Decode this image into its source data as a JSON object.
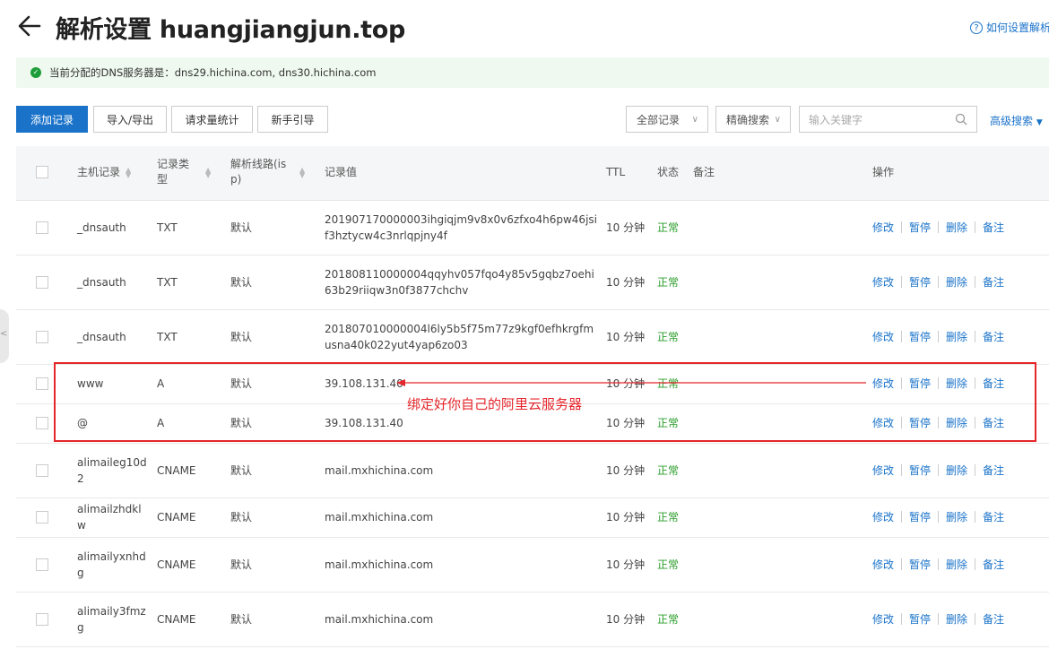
{
  "header": {
    "title": "解析设置 huangjiangjun.top",
    "help_label": "如何设置解析"
  },
  "notice": {
    "text": "当前分配的DNS服务器是：dns29.hichina.com, dns30.hichina.com"
  },
  "toolbar": {
    "add_label": "添加记录",
    "import_label": "导入/导出",
    "stats_label": "请求量统计",
    "guide_label": "新手引导",
    "filter_all": "全部记录",
    "search_mode": "精确搜索",
    "search_placeholder": "输入关键字",
    "advanced_label": "高级搜索"
  },
  "table": {
    "headers": {
      "host": "主机记录",
      "type": "记录类型",
      "line": "解析线路(isp)",
      "value": "记录值",
      "ttl": "TTL",
      "status": "状态",
      "remark": "备注",
      "ops": "操作"
    },
    "op_labels": [
      "修改",
      "暂停",
      "删除",
      "备注"
    ],
    "rows": [
      {
        "host": "_dnsauth",
        "type": "TXT",
        "line": "默认",
        "value": "201907170000003ihgiqjm9v8x0v6zfxo4h6pw46jsif3hztycw4c3nrlqpjny4f",
        "ttl": "10 分钟",
        "status": "正常"
      },
      {
        "host": "_dnsauth",
        "type": "TXT",
        "line": "默认",
        "value": "201808110000004qqyhv057fqo4y85v5gqbz7oehi63b29riiqw3n0f3877chchv",
        "ttl": "10 分钟",
        "status": "正常"
      },
      {
        "host": "_dnsauth",
        "type": "TXT",
        "line": "默认",
        "value": "201807010000004l6ly5b5f75m77z9kgf0efhkrgfmusna40k022yut4yap6zo03",
        "ttl": "10 分钟",
        "status": "正常"
      },
      {
        "host": "www",
        "type": "A",
        "line": "默认",
        "value": "39.108.131.40",
        "ttl": "10 分钟",
        "status": "正常"
      },
      {
        "host": "@",
        "type": "A",
        "line": "默认",
        "value": "39.108.131.40",
        "ttl": "10 分钟",
        "status": "正常"
      },
      {
        "host": "alimaileg10d2",
        "type": "CNAME",
        "line": "默认",
        "value": "mail.mxhichina.com",
        "ttl": "10 分钟",
        "status": "正常"
      },
      {
        "host": "alimailzhdklw",
        "type": "CNAME",
        "line": "默认",
        "value": "mail.mxhichina.com",
        "ttl": "10 分钟",
        "status": "正常"
      },
      {
        "host": "alimailyxnhdg",
        "type": "CNAME",
        "line": "默认",
        "value": "mail.mxhichina.com",
        "ttl": "10 分钟",
        "status": "正常"
      },
      {
        "host": "alimaily3fmzg",
        "type": "CNAME",
        "line": "默认",
        "value": "mail.mxhichina.com",
        "ttl": "10 分钟",
        "status": "正常"
      }
    ]
  },
  "annotation": {
    "text": "绑定好你自己的阿里云服务器",
    "color": "#e5262b"
  },
  "colors": {
    "accent": "#1a73c9",
    "status_ok": "#2a9d2a"
  }
}
